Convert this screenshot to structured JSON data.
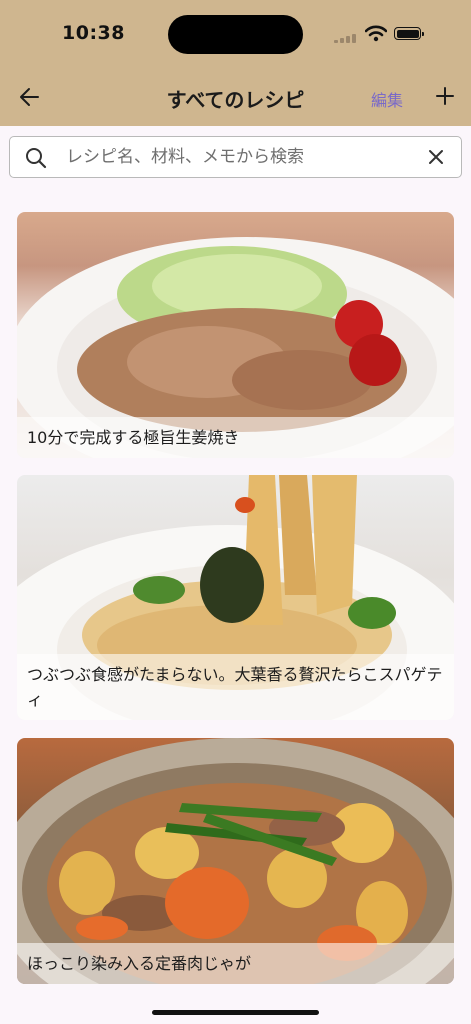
{
  "status_bar": {
    "time": "10:38"
  },
  "nav": {
    "title": "すべてのレシピ",
    "edit_label": "編集"
  },
  "search": {
    "placeholder": "レシピ名、材料、メモから検索",
    "value": ""
  },
  "recipes": [
    {
      "title": "10分で完成する極旨生姜焼き"
    },
    {
      "title": "つぶつぶ食感がたまらない。大葉香る贅沢たらこスパゲティ"
    },
    {
      "title": "ほっこり染み入る定番肉じゃが"
    }
  ],
  "icons": {
    "back": "arrow-left-icon",
    "add": "plus-icon",
    "search": "search-icon",
    "clear": "close-icon"
  },
  "colors": {
    "header": "#cfb68f",
    "accent": "#7a6ac8",
    "background": "#fbf6fb"
  }
}
